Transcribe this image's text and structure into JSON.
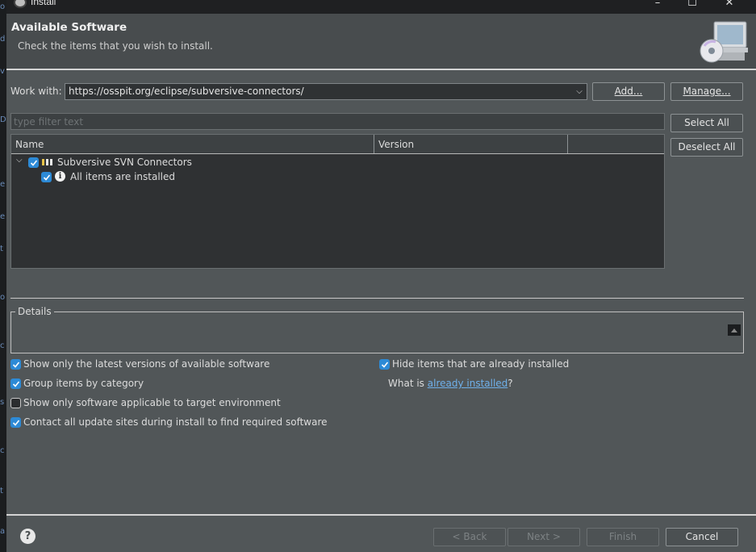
{
  "window": {
    "title": "Install"
  },
  "header": {
    "title": "Available Software",
    "description": "Check the items that you wish to install."
  },
  "work_with": {
    "label": "Work with:",
    "value": "https://osspit.org/eclipse/subversive-connectors/",
    "add_label": "Add...",
    "manage_label": "Manage..."
  },
  "filter": {
    "placeholder": "type filter text"
  },
  "selection_buttons": {
    "select_all": "Select All",
    "deselect_all": "Deselect All"
  },
  "table": {
    "columns": [
      "Name",
      "Version"
    ],
    "rows": [
      {
        "name": "Subversive SVN Connectors",
        "version": "",
        "checked": true,
        "expanded": true,
        "icon": "category-icon"
      },
      {
        "name": "All items are installed",
        "version": "",
        "checked": true,
        "icon": "info-icon"
      }
    ]
  },
  "details": {
    "label": "Details"
  },
  "options": {
    "latest_versions": {
      "label": "Show only the latest versions of available software",
      "checked": true
    },
    "group_by_category": {
      "label": "Group items by category",
      "checked": true
    },
    "target_env": {
      "label": "Show only software applicable to target environment",
      "checked": false
    },
    "contact_sites": {
      "label": "Contact all update sites during install to find required software",
      "checked": true
    },
    "hide_installed": {
      "label": "Hide items that are already installed",
      "checked": true
    },
    "what_is_prefix": "What is ",
    "what_is_link": "already installed",
    "what_is_suffix": "?"
  },
  "footer": {
    "back": "< Back",
    "next": "Next >",
    "finish": "Finish",
    "cancel": "Cancel"
  },
  "colors": {
    "accent": "#2d8ad6",
    "link": "#6fb0ea",
    "dialog_bg": "#515658"
  }
}
